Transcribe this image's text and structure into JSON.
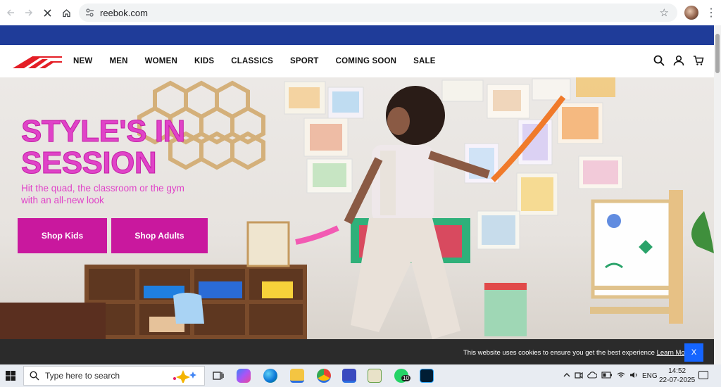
{
  "browser": {
    "url": "reebok.com",
    "back_icon": "arrow-left-icon",
    "forward_icon": "arrow-right-icon",
    "stop_icon": "close-icon",
    "home_icon": "home-icon"
  },
  "site": {
    "nav": [
      "NEW",
      "MEN",
      "WOMEN",
      "KIDS",
      "CLASSICS",
      "SPORT",
      "COMING SOON",
      "SALE"
    ],
    "promo_color": "#1f3c99",
    "accent": "#e043c8"
  },
  "hero": {
    "headline_line1": "STYLE'S IN",
    "headline_line2": "SESSION",
    "subhead_line1": "Hit the quad, the classroom or the gym",
    "subhead_line2": "with an all-new look",
    "cta_kids": "Shop Kids",
    "cta_adults": "Shop Adults"
  },
  "cookie": {
    "message": "This website uses cookies to ensure you get the best experience",
    "link": "Learn More",
    "close": "X"
  },
  "taskbar": {
    "search_placeholder": "Type here to search",
    "language": "ENG",
    "time": "14:52",
    "date": "22-07-2025",
    "whatsapp_badge": "10"
  }
}
